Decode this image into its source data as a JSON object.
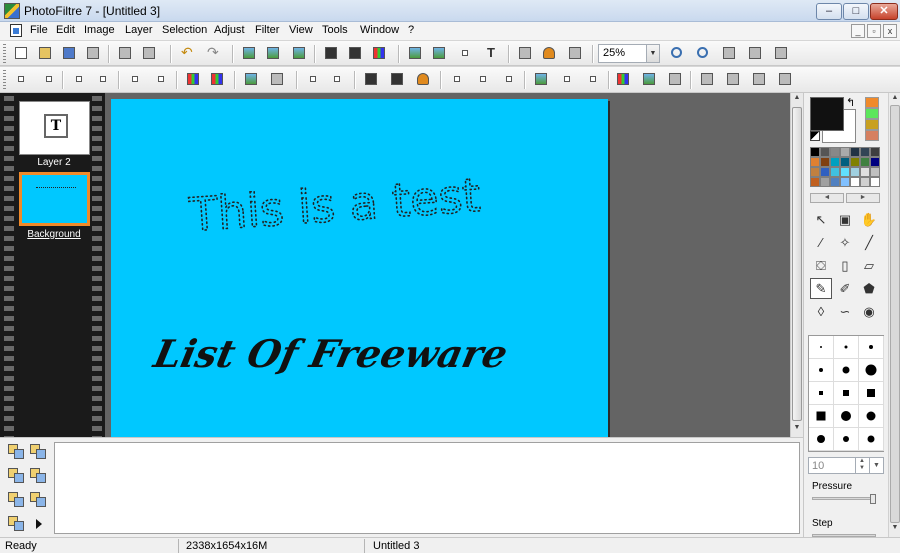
{
  "window": {
    "title": "PhotoFiltre 7 - [Untitled 3]"
  },
  "window_controls": {
    "minimize": "–",
    "maximize": "□",
    "close": "✕"
  },
  "menu": {
    "items": [
      "File",
      "Edit",
      "Image",
      "Layer",
      "Selection",
      "Adjust",
      "Filter",
      "View",
      "Tools",
      "Window",
      "?"
    ],
    "mdi_controls": [
      "_",
      "▫",
      "x"
    ]
  },
  "toolbar": {
    "zoom_value": "25%"
  },
  "layers": [
    {
      "label": "Layer 2",
      "thumb_icon": "T"
    },
    {
      "label": "Background",
      "selected": true
    }
  ],
  "canvas": {
    "background_color": "#00c8ff",
    "handwritten_text": "This is a test",
    "title_text": "List Of Freeware"
  },
  "status": {
    "state": "Ready",
    "image_info": "2338x1654x16M",
    "document": "Untitled 3"
  },
  "tools_panel": {
    "foreground_color": "#111111",
    "background_color": "#ffffff",
    "recent_colors": [
      "#f08a2a",
      "#5ce65c",
      "#c8a020",
      "#d68060"
    ],
    "palette": [
      "#000000",
      "#555555",
      "#888888",
      "#aaaaaa",
      "#223344",
      "#334455",
      "#3f3f3f",
      "#e08030",
      "#804010",
      "#00a0c0",
      "#006080",
      "#808000",
      "#408040",
      "#000080",
      "#c08040",
      "#3060c0",
      "#40c0e0",
      "#60e0ff",
      "#a0d0e0",
      "#e0e0e0",
      "#c0c0c0",
      "#c06020",
      "#a0a0a0",
      "#5080c0",
      "#80c0ff",
      "#ffffff",
      "#d0d0d0",
      "#ffffff"
    ],
    "tools": [
      {
        "name": "pointer-icon",
        "glyph": "↖"
      },
      {
        "name": "selection-icon",
        "glyph": "▣"
      },
      {
        "name": "hand-icon",
        "glyph": "✋"
      },
      {
        "name": "eyedropper-icon",
        "glyph": "⁄"
      },
      {
        "name": "magic-wand-icon",
        "glyph": "✧"
      },
      {
        "name": "line-icon",
        "glyph": "╱"
      },
      {
        "name": "fill-bucket-icon",
        "glyph": "⛋"
      },
      {
        "name": "spray-icon",
        "glyph": "▯"
      },
      {
        "name": "eraser-icon",
        "glyph": "▱"
      },
      {
        "name": "brush-icon",
        "glyph": "✎"
      },
      {
        "name": "advanced-brush-icon",
        "glyph": "✐"
      },
      {
        "name": "stamp-icon",
        "glyph": "⬟"
      },
      {
        "name": "blur-icon",
        "glyph": "◊"
      },
      {
        "name": "smudge-icon",
        "glyph": "∽"
      },
      {
        "name": "clone-icon",
        "glyph": "◉"
      }
    ],
    "active_tool_index": 9,
    "brush_size": "10",
    "pressure_label": "Pressure",
    "step_label": "Step"
  }
}
